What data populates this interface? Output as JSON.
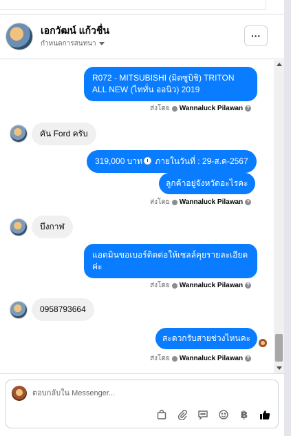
{
  "header": {
    "name": "เอกวัฒน์ แก้วชื่น",
    "status": "กำหนดการสนทนา",
    "more_label": "···"
  },
  "messages": [
    {
      "id": "m1",
      "type": "outgoing",
      "text": "R072 - MITSUBISHI (มิตซูบิชิ) TRITON ALL NEW (ไททั่น ออนิว) 2019"
    },
    {
      "id": "s1",
      "type": "sender",
      "prefix": "ส่งโดย",
      "name": "Wannaluck Pilawan"
    },
    {
      "id": "m2",
      "type": "incoming",
      "text": "คัน Ford ครับ"
    },
    {
      "id": "m3",
      "type": "outgoing",
      "text_before": "319,000 บาท",
      "text_after": " ภายในวันที่ : 29-ส.ค-2567",
      "emoji": "clock-icon"
    },
    {
      "id": "m4",
      "type": "outgoing",
      "text": "ลูกค้าอยู่จังหวัดอะไรคะ"
    },
    {
      "id": "s2",
      "type": "sender",
      "prefix": "ส่งโดย",
      "name": "Wannaluck Pilawan"
    },
    {
      "id": "m5",
      "type": "incoming",
      "text": "บึงกาฬ"
    },
    {
      "id": "m6",
      "type": "outgoing",
      "text": "แอดมินขอเบอร์ติดต่อให้เซลล์คุยรายละเอียดค่ะ"
    },
    {
      "id": "s3",
      "type": "sender",
      "prefix": "ส่งโดย",
      "name": "Wannaluck Pilawan"
    },
    {
      "id": "m7",
      "type": "incoming",
      "text": "0958793664"
    },
    {
      "id": "m8",
      "type": "outgoing",
      "text": "สะดวกรับสายช่วงไหนคะ"
    },
    {
      "id": "s4",
      "type": "sender",
      "prefix": "ส่งโดย",
      "name": "Wannaluck Pilawan"
    }
  ],
  "help_symbol": "?",
  "composer": {
    "placeholder": "ตอบกลับใน Messenger...",
    "tools": [
      "bag-icon",
      "attach-icon",
      "chat-bubble-icon",
      "emoji-icon",
      "baht-icon",
      "thumbs-up-icon"
    ],
    "baht_symbol": "฿"
  },
  "colors": {
    "outgoing_bubble": "#0a7cff",
    "incoming_bubble": "#f0f0f0",
    "like_icon": "#050505"
  }
}
